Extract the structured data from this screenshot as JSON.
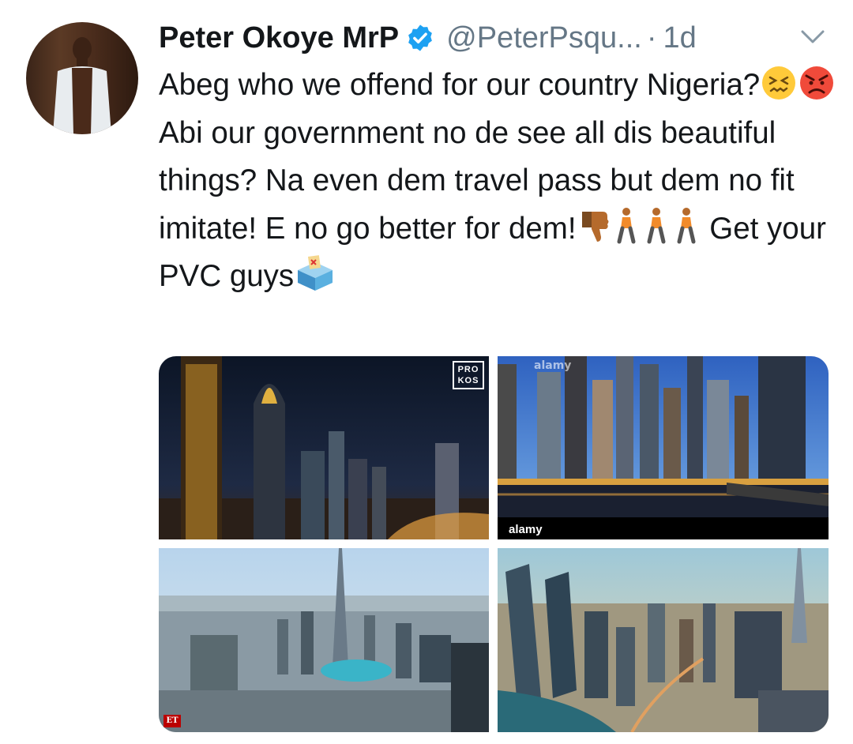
{
  "tweet": {
    "author_name": "Peter Okoye MrP",
    "handle": "@PeterPsqu...",
    "separator": "·",
    "timestamp": "1d",
    "text_parts": {
      "p1": "Abeg who we offend for our country Nigeria?",
      "p2": " Abi our government no de see all dis beautiful things? Na even dem travel pass but dem no fit imitate! E no go better for dem!",
      "p3": " Get your PVC guys"
    },
    "emojis": [
      "confounded-face",
      "angry-face",
      "thumbs-down",
      "person-walking",
      "person-walking",
      "person-walking",
      "ballot-box"
    ]
  },
  "media": {
    "images": [
      {
        "description_name": "dubai-night-skyline",
        "watermark": "PRO KOS"
      },
      {
        "description_name": "dubai-marina-evening",
        "watermark": "alamy",
        "watermark_secondary": "alamy"
      },
      {
        "description_name": "dubai-aerial-burj-khalifa",
        "watermark": "ET"
      },
      {
        "description_name": "dubai-business-bay-aerial"
      }
    ]
  },
  "colors": {
    "text": "#14171a",
    "secondary": "#657786",
    "verified": "#1da1f2"
  }
}
